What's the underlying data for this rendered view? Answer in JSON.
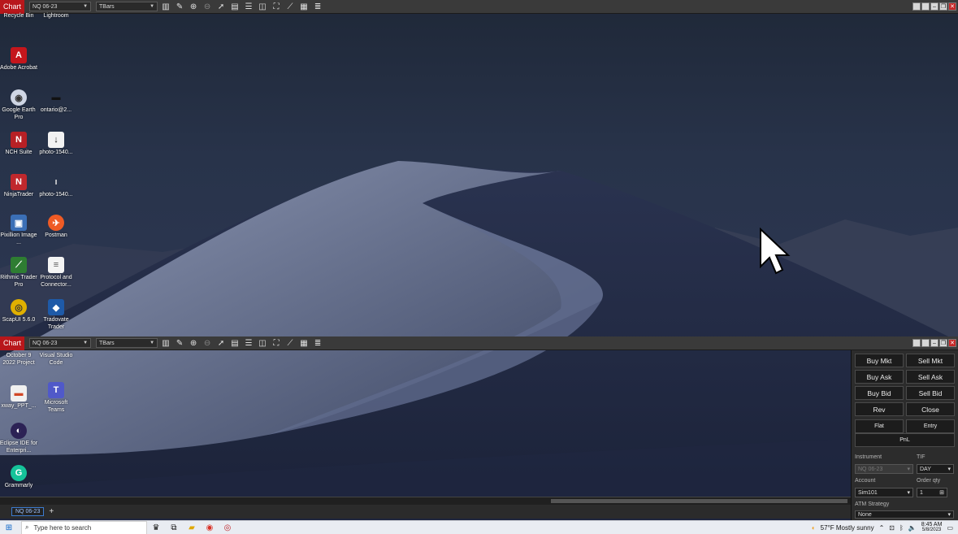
{
  "chart_windows": [
    {
      "tab_label": "Chart",
      "instrument": "NQ 06-23",
      "bar_type": "TBars",
      "tools": [
        "bar-chart-icon",
        "pencil-icon",
        "zoom-in-icon",
        "zoom-out-icon",
        "pointer-icon",
        "data-box-icon",
        "properties-icon",
        "window-split-icon",
        "fullscreen-icon",
        "strategy-icon",
        "calculator-icon",
        "list-icon"
      ]
    },
    {
      "tab_label": "Chart",
      "instrument": "NQ 06-23",
      "bar_type": "TBars",
      "tools": [
        "bar-chart-icon",
        "pencil-icon",
        "zoom-in-icon",
        "zoom-out-icon",
        "pointer-icon",
        "data-box-icon",
        "properties-icon",
        "window-split-icon",
        "fullscreen-icon",
        "strategy-icon",
        "calculator-icon",
        "list-icon"
      ]
    }
  ],
  "desktop_icons": [
    {
      "label": "Recycle Bin",
      "icon": "recycle-bin-icon",
      "color": "#8a9bb8"
    },
    {
      "label": "Lightroom",
      "icon": "lightroom-icon",
      "color": "#2a3b6e"
    },
    {
      "label": "Adobe Acrobat",
      "icon": "acrobat-icon",
      "color": "#c4161c"
    },
    {
      "label": "Google Earth Pro",
      "icon": "google-earth-icon",
      "color": "#cfd6e4"
    },
    {
      "label": "ontario@2...",
      "icon": "file-icon",
      "color": "#202020"
    },
    {
      "label": "NCH Suite",
      "icon": "nch-icon",
      "color": "#b72025"
    },
    {
      "label": "photo-1540...",
      "icon": "image-file-icon",
      "color": "#f2f2f2"
    },
    {
      "label": "NinjaTrader",
      "icon": "ninjatrader-icon",
      "color": "#c0282d"
    },
    {
      "label": "photo-1540...",
      "icon": "image-file-icon",
      "color": "#1a1a1a"
    },
    {
      "label": "Pixillion Image ...",
      "icon": "pixillion-icon",
      "color": "#3b6fb6"
    },
    {
      "label": "Postman",
      "icon": "postman-icon",
      "color": "#ef5b25"
    },
    {
      "label": "Rithmic Trader Pro",
      "icon": "rithmic-icon",
      "color": "#2e7d32"
    },
    {
      "label": "Protocol and Connector...",
      "icon": "document-icon",
      "color": "#f4f4f4"
    },
    {
      "label": "ScapUI 5.6.0",
      "icon": "scapui-icon",
      "color": "#e0b000"
    },
    {
      "label": "Tradovate Trader",
      "icon": "tradovate-icon",
      "color": "#1e5aa8"
    },
    {
      "label": "October 9 2022 Project",
      "icon": "folder-icon",
      "color": "#e0b050"
    },
    {
      "label": "Visual Studio Code",
      "icon": "vscode-icon",
      "color": "#2377c8"
    },
    {
      "label": "xway_PPT_...",
      "icon": "ppt-file-icon",
      "color": "#d24726"
    },
    {
      "label": "Microsoft Teams",
      "icon": "teams-icon",
      "color": "#5059c9"
    },
    {
      "label": "Eclipse IDE for Enterpri...",
      "icon": "eclipse-icon",
      "color": "#2c2255"
    },
    {
      "label": "Grammarly",
      "icon": "grammarly-icon",
      "color": "#15c39a"
    }
  ],
  "chart_tabs": {
    "active_tab": "NQ 06-23",
    "add_label": "+"
  },
  "order_panel": {
    "buttons": {
      "buy_mkt": "Buy Mkt",
      "sell_mkt": "Sell Mkt",
      "buy_ask": "Buy Ask",
      "sell_ask": "Sell Ask",
      "buy_bid": "Buy Bid",
      "sell_bid": "Sell Bid",
      "rev": "Rev",
      "close": "Close",
      "flat": "Flat",
      "entry": "Entry",
      "pnl": "PnL"
    },
    "instrument_label": "Instrument",
    "instrument_value": "NQ 06-23",
    "tif_label": "TIF",
    "tif_value": "DAY",
    "account_label": "Account",
    "account_value": "Sim101",
    "order_qty_label": "Order qty",
    "order_qty_value": "1",
    "atm_label": "ATM Strategy",
    "atm_value": "None"
  },
  "taskbar": {
    "search_placeholder": "Type here to search",
    "weather": "57°F  Mostly sunny",
    "time": "8:45 AM",
    "date": "5/8/2023"
  }
}
